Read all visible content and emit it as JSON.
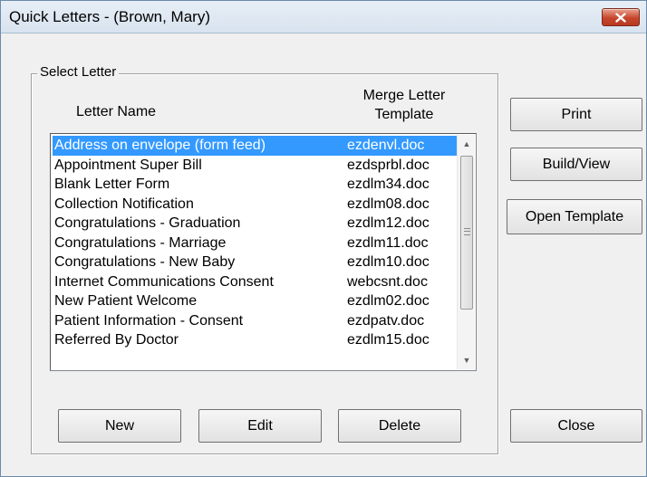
{
  "window": {
    "title": "Quick Letters - (Brown, Mary)"
  },
  "group": {
    "label": "Select Letter"
  },
  "columns": {
    "name_header": "Letter Name",
    "template_header_line1": "Merge Letter",
    "template_header_line2": "Template"
  },
  "letters": [
    {
      "name": "Address on envelope (form feed)",
      "template": "ezdenvl.doc",
      "selected": true
    },
    {
      "name": "Appointment Super Bill",
      "template": "ezdsprbl.doc"
    },
    {
      "name": "Blank Letter Form",
      "template": "ezdlm34.doc"
    },
    {
      "name": "Collection Notification",
      "template": "ezdlm08.doc"
    },
    {
      "name": "Congratulations - Graduation",
      "template": "ezdlm12.doc"
    },
    {
      "name": "Congratulations - Marriage",
      "template": "ezdlm11.doc"
    },
    {
      "name": "Congratulations - New Baby",
      "template": "ezdlm10.doc"
    },
    {
      "name": "Internet Communications Consent",
      "template": "webcsnt.doc"
    },
    {
      "name": "New Patient Welcome",
      "template": "ezdlm02.doc"
    },
    {
      "name": "Patient Information - Consent",
      "template": "ezdpatv.doc"
    },
    {
      "name": "Referred By Doctor",
      "template": "ezdlm15.doc"
    }
  ],
  "buttons": {
    "print": "Print",
    "build_view": "Build/View",
    "open_template": "Open Template",
    "new": "New",
    "edit": "Edit",
    "delete": "Delete",
    "close": "Close"
  },
  "colors": {
    "selection": "#3399ff",
    "close_button": "#c7462b"
  }
}
